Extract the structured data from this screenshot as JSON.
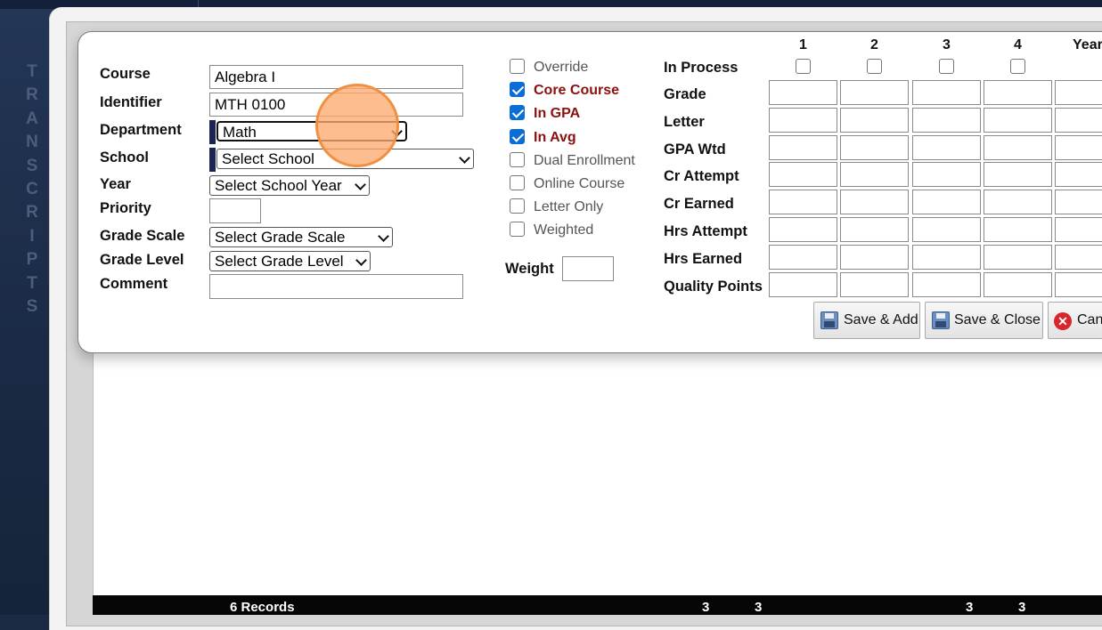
{
  "sidebar": {
    "vertical_title_letters": [
      "T",
      "R",
      "A",
      "N",
      "S",
      "C",
      "R",
      "I",
      "P",
      "T",
      "S"
    ]
  },
  "form": {
    "course": {
      "label": "Course",
      "value": "Algebra I"
    },
    "identifier": {
      "label": "Identifier",
      "value": "MTH 0100"
    },
    "department": {
      "label": "Department",
      "value": "Math"
    },
    "school": {
      "label": "School",
      "value": "Select School"
    },
    "year": {
      "label": "Year",
      "value": "Select School Year"
    },
    "priority": {
      "label": "Priority",
      "value": ""
    },
    "grade_scale": {
      "label": "Grade Scale",
      "value": "Select Grade Scale"
    },
    "grade_level": {
      "label": "Grade Level",
      "value": "Select Grade Level"
    },
    "comment": {
      "label": "Comment",
      "value": ""
    }
  },
  "options": [
    {
      "label": "Override",
      "checked": false,
      "emphasis": false
    },
    {
      "label": "Core Course",
      "checked": true,
      "emphasis": true
    },
    {
      "label": "In GPA",
      "checked": true,
      "emphasis": true
    },
    {
      "label": "In Avg",
      "checked": true,
      "emphasis": true
    },
    {
      "label": "Dual Enrollment",
      "checked": false,
      "emphasis": false
    },
    {
      "label": "Online Course",
      "checked": false,
      "emphasis": false
    },
    {
      "label": "Letter Only",
      "checked": false,
      "emphasis": false
    },
    {
      "label": "Weighted",
      "checked": false,
      "emphasis": false
    }
  ],
  "weight": {
    "label": "Weight",
    "value": ""
  },
  "grid": {
    "columns": [
      "1",
      "2",
      "3",
      "4",
      "Year"
    ],
    "in_process_label": "In Process",
    "rows": [
      "Grade",
      "Letter",
      "GPA Wtd",
      "Cr Attempt",
      "Cr Earned",
      "Hrs Attempt",
      "Hrs Earned",
      "Quality Points"
    ]
  },
  "buttons": {
    "save_add": "Save & Add",
    "save_close": "Save & Close",
    "cancel": "Canc"
  },
  "footer": {
    "records": "6 Records",
    "totals": [
      "3",
      "3",
      "3",
      "3"
    ]
  },
  "colors": {
    "emphasis_red": "#8b1010",
    "checkbox_blue": "#0b6dd6",
    "cursor_highlight": "#fcaa6e"
  }
}
